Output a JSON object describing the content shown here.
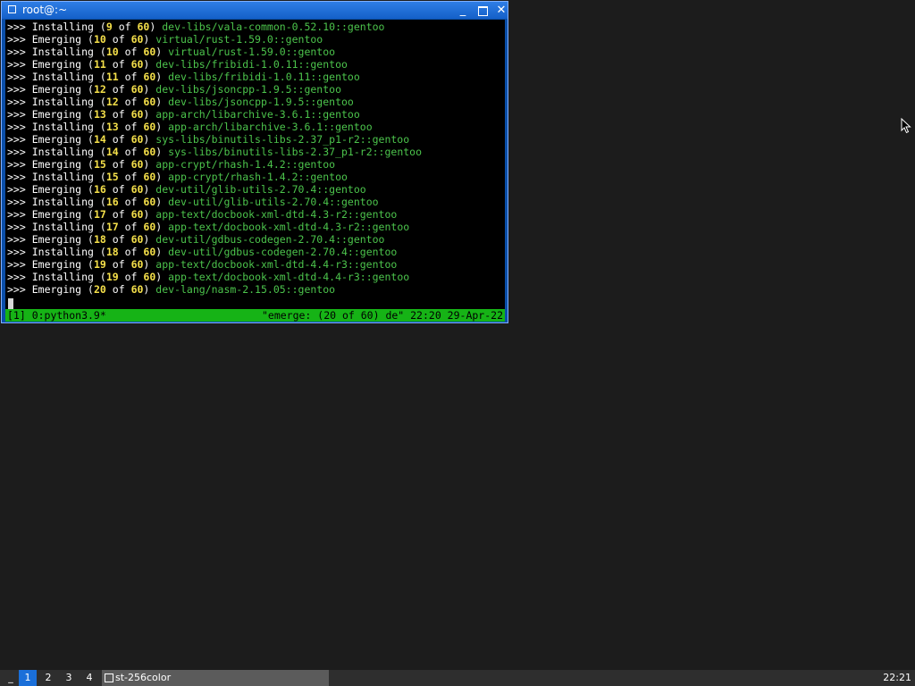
{
  "window": {
    "title": "root@:~",
    "minimize_glyph": "_",
    "close_glyph": "✕"
  },
  "terminal": {
    "lines": [
      {
        "prompt": ">>>",
        "action": "Installing",
        "current": "9",
        "of": "of",
        "total": "60",
        "package": "dev-libs/vala-common-0.52.10::gentoo"
      },
      {
        "prompt": ">>>",
        "action": "Emerging",
        "current": "10",
        "of": "of",
        "total": "60",
        "package": "virtual/rust-1.59.0::gentoo"
      },
      {
        "prompt": ">>>",
        "action": "Installing",
        "current": "10",
        "of": "of",
        "total": "60",
        "package": "virtual/rust-1.59.0::gentoo"
      },
      {
        "prompt": ">>>",
        "action": "Emerging",
        "current": "11",
        "of": "of",
        "total": "60",
        "package": "dev-libs/fribidi-1.0.11::gentoo"
      },
      {
        "prompt": ">>>",
        "action": "Installing",
        "current": "11",
        "of": "of",
        "total": "60",
        "package": "dev-libs/fribidi-1.0.11::gentoo"
      },
      {
        "prompt": ">>>",
        "action": "Emerging",
        "current": "12",
        "of": "of",
        "total": "60",
        "package": "dev-libs/jsoncpp-1.9.5::gentoo"
      },
      {
        "prompt": ">>>",
        "action": "Installing",
        "current": "12",
        "of": "of",
        "total": "60",
        "package": "dev-libs/jsoncpp-1.9.5::gentoo"
      },
      {
        "prompt": ">>>",
        "action": "Emerging",
        "current": "13",
        "of": "of",
        "total": "60",
        "package": "app-arch/libarchive-3.6.1::gentoo"
      },
      {
        "prompt": ">>>",
        "action": "Installing",
        "current": "13",
        "of": "of",
        "total": "60",
        "package": "app-arch/libarchive-3.6.1::gentoo"
      },
      {
        "prompt": ">>>",
        "action": "Emerging",
        "current": "14",
        "of": "of",
        "total": "60",
        "package": "sys-libs/binutils-libs-2.37_p1-r2::gentoo"
      },
      {
        "prompt": ">>>",
        "action": "Installing",
        "current": "14",
        "of": "of",
        "total": "60",
        "package": "sys-libs/binutils-libs-2.37_p1-r2::gentoo"
      },
      {
        "prompt": ">>>",
        "action": "Emerging",
        "current": "15",
        "of": "of",
        "total": "60",
        "package": "app-crypt/rhash-1.4.2::gentoo"
      },
      {
        "prompt": ">>>",
        "action": "Installing",
        "current": "15",
        "of": "of",
        "total": "60",
        "package": "app-crypt/rhash-1.4.2::gentoo"
      },
      {
        "prompt": ">>>",
        "action": "Emerging",
        "current": "16",
        "of": "of",
        "total": "60",
        "package": "dev-util/glib-utils-2.70.4::gentoo"
      },
      {
        "prompt": ">>>",
        "action": "Installing",
        "current": "16",
        "of": "of",
        "total": "60",
        "package": "dev-util/glib-utils-2.70.4::gentoo"
      },
      {
        "prompt": ">>>",
        "action": "Emerging",
        "current": "17",
        "of": "of",
        "total": "60",
        "package": "app-text/docbook-xml-dtd-4.3-r2::gentoo"
      },
      {
        "prompt": ">>>",
        "action": "Installing",
        "current": "17",
        "of": "of",
        "total": "60",
        "package": "app-text/docbook-xml-dtd-4.3-r2::gentoo"
      },
      {
        "prompt": ">>>",
        "action": "Emerging",
        "current": "18",
        "of": "of",
        "total": "60",
        "package": "dev-util/gdbus-codegen-2.70.4::gentoo"
      },
      {
        "prompt": ">>>",
        "action": "Installing",
        "current": "18",
        "of": "of",
        "total": "60",
        "package": "dev-util/gdbus-codegen-2.70.4::gentoo"
      },
      {
        "prompt": ">>>",
        "action": "Emerging",
        "current": "19",
        "of": "of",
        "total": "60",
        "package": "app-text/docbook-xml-dtd-4.4-r3::gentoo"
      },
      {
        "prompt": ">>>",
        "action": "Installing",
        "current": "19",
        "of": "of",
        "total": "60",
        "package": "app-text/docbook-xml-dtd-4.4-r3::gentoo"
      },
      {
        "prompt": ">>>",
        "action": "Emerging",
        "current": "20",
        "of": "of",
        "total": "60",
        "package": "dev-lang/nasm-2.15.05::gentoo"
      }
    ],
    "status_left": "[1] 0:python3.9*",
    "status_right": "\"emerge: (20 of 60) de\" 22:20 29-Apr-22"
  },
  "taskbar": {
    "minimize_label": "_",
    "workspaces": [
      "1",
      "2",
      "3",
      "4"
    ],
    "active_workspace": "1",
    "task_label": "st-256color",
    "clock": "22:21"
  },
  "colors": {
    "terminal_bg": "#000000",
    "number": "#f5e04a",
    "package": "#4cc44c",
    "status_bar": "#16b316",
    "titlebar": "#1e6fdc",
    "active_workspace": "#1a6fd9"
  }
}
